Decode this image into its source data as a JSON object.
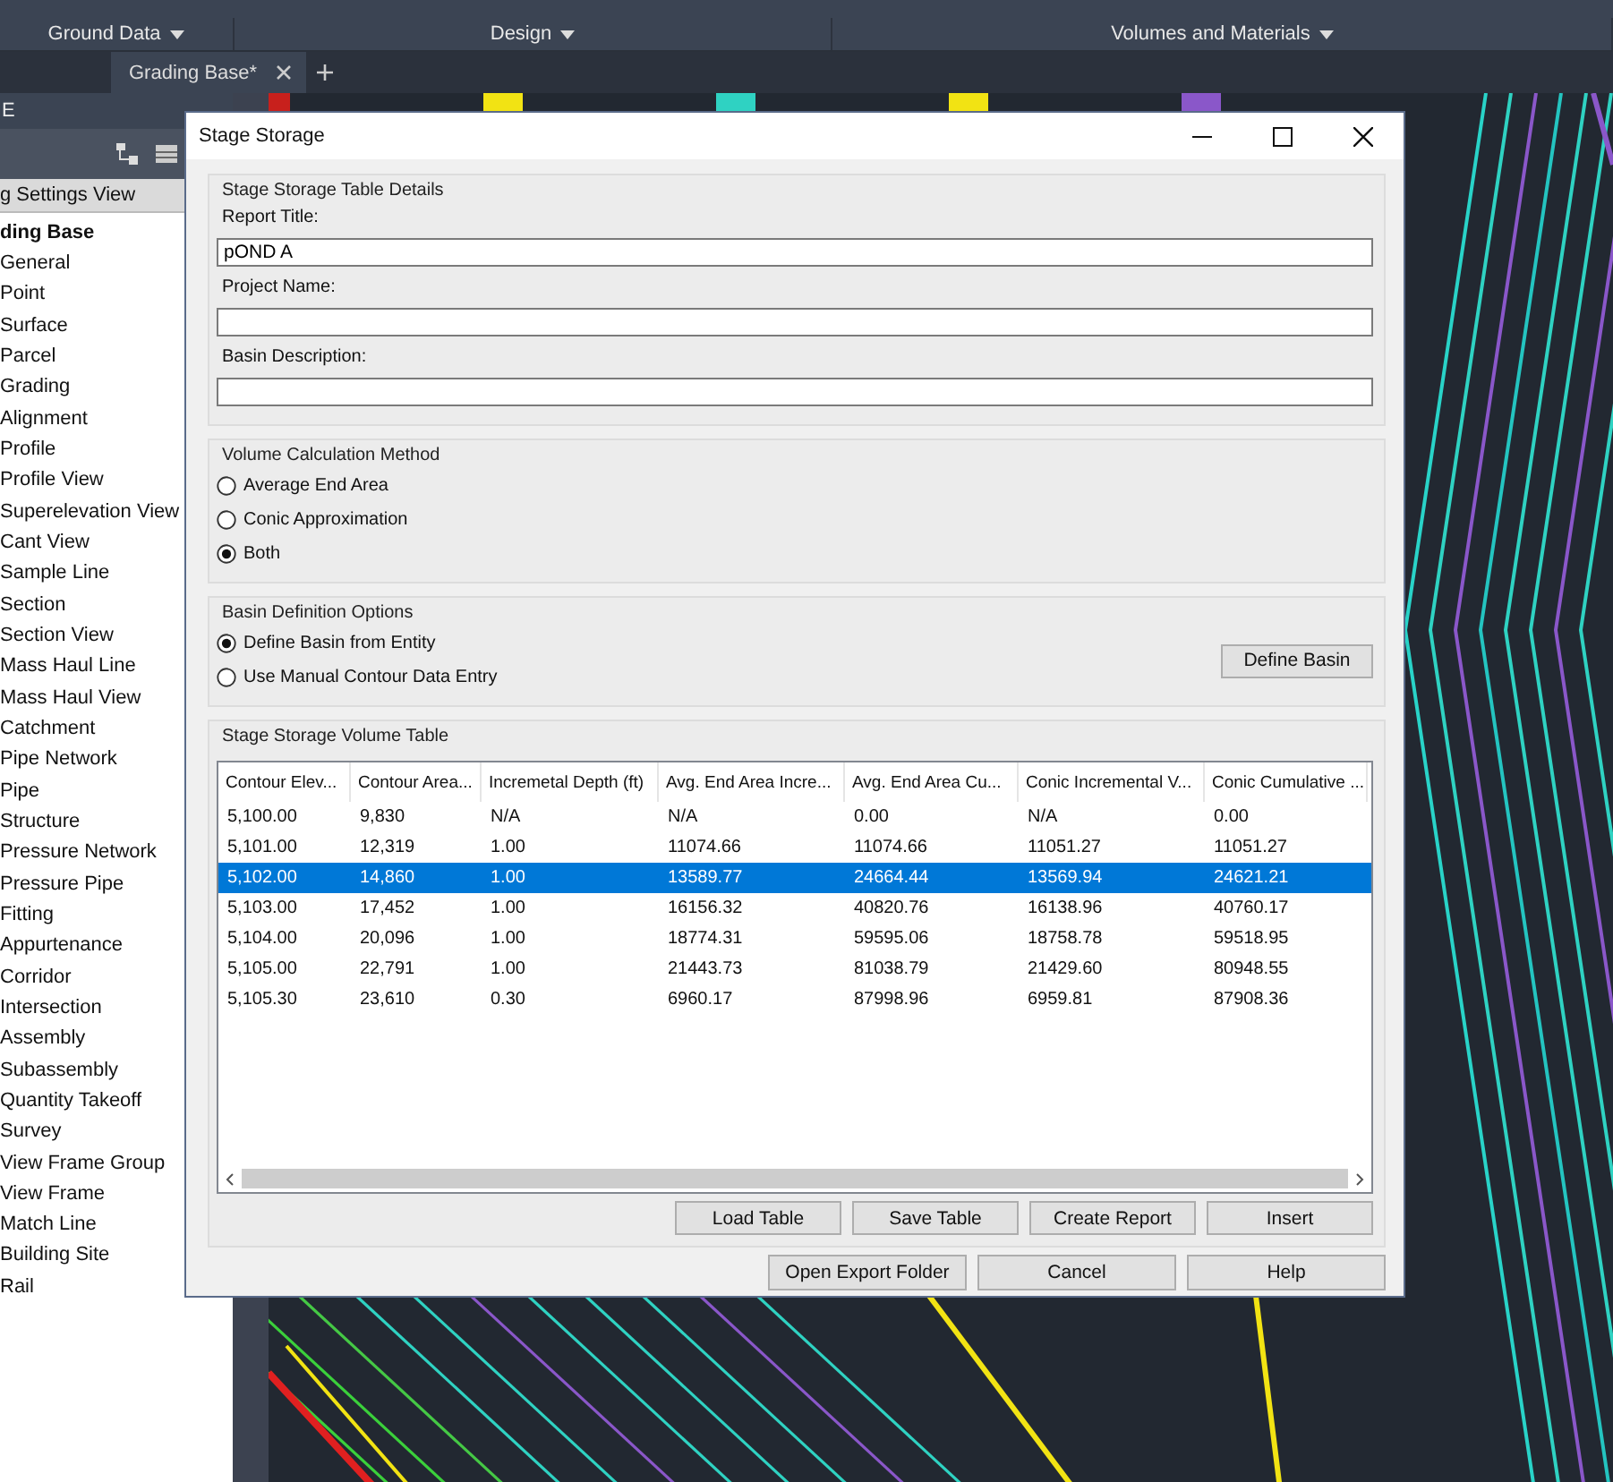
{
  "ribbon": {
    "panels": [
      {
        "label": "Ground Data"
      },
      {
        "label": "Design"
      },
      {
        "label": "Volumes and Materials"
      }
    ]
  },
  "tabs": [
    {
      "label": "Grading Base*",
      "selected": true
    }
  ],
  "toolspace": {
    "title": "E",
    "view_label": "g Settings View",
    "tree": [
      {
        "label": "ding Base",
        "children": [
          {
            "label": "General"
          },
          {
            "label": "Point"
          },
          {
            "label": "Surface"
          },
          {
            "label": "Parcel"
          },
          {
            "label": "Grading"
          },
          {
            "label": "Alignment"
          },
          {
            "label": "Profile"
          },
          {
            "label": "Profile View"
          },
          {
            "label": "Superelevation View"
          },
          {
            "label": "Cant View"
          },
          {
            "label": "Sample Line"
          },
          {
            "label": "Section"
          },
          {
            "label": "Section View"
          },
          {
            "label": "Mass Haul Line"
          },
          {
            "label": "Mass Haul View"
          },
          {
            "label": "Catchment"
          },
          {
            "label": "Pipe Network"
          },
          {
            "label": "Pipe"
          },
          {
            "label": "Structure"
          },
          {
            "label": "Pressure Network"
          },
          {
            "label": "Pressure Pipe"
          },
          {
            "label": "Fitting"
          },
          {
            "label": "Appurtenance"
          },
          {
            "label": "Corridor"
          },
          {
            "label": "Intersection"
          },
          {
            "label": "Assembly"
          },
          {
            "label": "Subassembly"
          },
          {
            "label": "Quantity Takeoff"
          },
          {
            "label": "Survey"
          },
          {
            "label": "View Frame Group"
          },
          {
            "label": "View Frame"
          },
          {
            "label": "Match Line"
          },
          {
            "label": "Building Site"
          },
          {
            "label": "Rail"
          }
        ]
      }
    ]
  },
  "dialog": {
    "title": "Stage Storage",
    "details": {
      "legend": "Stage Storage Table Details",
      "fields": [
        {
          "label": "Report Title:",
          "value": "pOND A"
        },
        {
          "label": "Project Name:"
        },
        {
          "label": "Basin Description:"
        }
      ]
    },
    "volume_method": {
      "legend": "Volume Calculation Method",
      "options": [
        {
          "label": "Average End Area",
          "selected": false
        },
        {
          "label": "Conic Approximation",
          "selected": false
        },
        {
          "label": "Both",
          "selected": true
        }
      ]
    },
    "basin_options": {
      "legend": "Basin Definition Options",
      "options": [
        {
          "label": "Define Basin from Entity",
          "selected": true
        },
        {
          "label": "Use Manual Contour Data Entry",
          "selected": false
        }
      ],
      "button": "Define Basin"
    },
    "volume_table": {
      "legend": "Stage Storage Volume Table",
      "columns": [
        "Contour Elev...",
        "Contour Area...",
        "Incremetal Depth (ft)",
        "Avg. End Area Incre...",
        "Avg. End Area Cu...",
        "Conic Incremental V...",
        "Conic Cumulative ..."
      ],
      "rows": [
        {
          "cells": [
            "5,100.00",
            "9,830",
            "N/A",
            "N/A",
            "0.00",
            "N/A",
            "0.00"
          ],
          "selected": false
        },
        {
          "cells": [
            "5,101.00",
            "12,319",
            "1.00",
            "11074.66",
            "11074.66",
            "11051.27",
            "11051.27"
          ],
          "selected": false
        },
        {
          "cells": [
            "5,102.00",
            "14,860",
            "1.00",
            "13589.77",
            "24664.44",
            "13569.94",
            "24621.21"
          ],
          "selected": true
        },
        {
          "cells": [
            "5,103.00",
            "17,452",
            "1.00",
            "16156.32",
            "40820.76",
            "16138.96",
            "40760.17"
          ],
          "selected": false
        },
        {
          "cells": [
            "5,104.00",
            "20,096",
            "1.00",
            "18774.31",
            "59595.06",
            "18758.78",
            "59518.95"
          ],
          "selected": false
        },
        {
          "cells": [
            "5,105.00",
            "22,791",
            "1.00",
            "21443.73",
            "81038.79",
            "21429.60",
            "80948.55"
          ],
          "selected": false
        },
        {
          "cells": [
            "5,105.30",
            "23,610",
            "0.30",
            "6960.17",
            "87998.96",
            "6959.81",
            "87908.36"
          ],
          "selected": false
        }
      ],
      "buttons": [
        "Load Table",
        "Save Table",
        "Create Report",
        "Insert"
      ]
    },
    "buttons": [
      "Open Export Folder",
      "Cancel",
      "Help"
    ]
  }
}
